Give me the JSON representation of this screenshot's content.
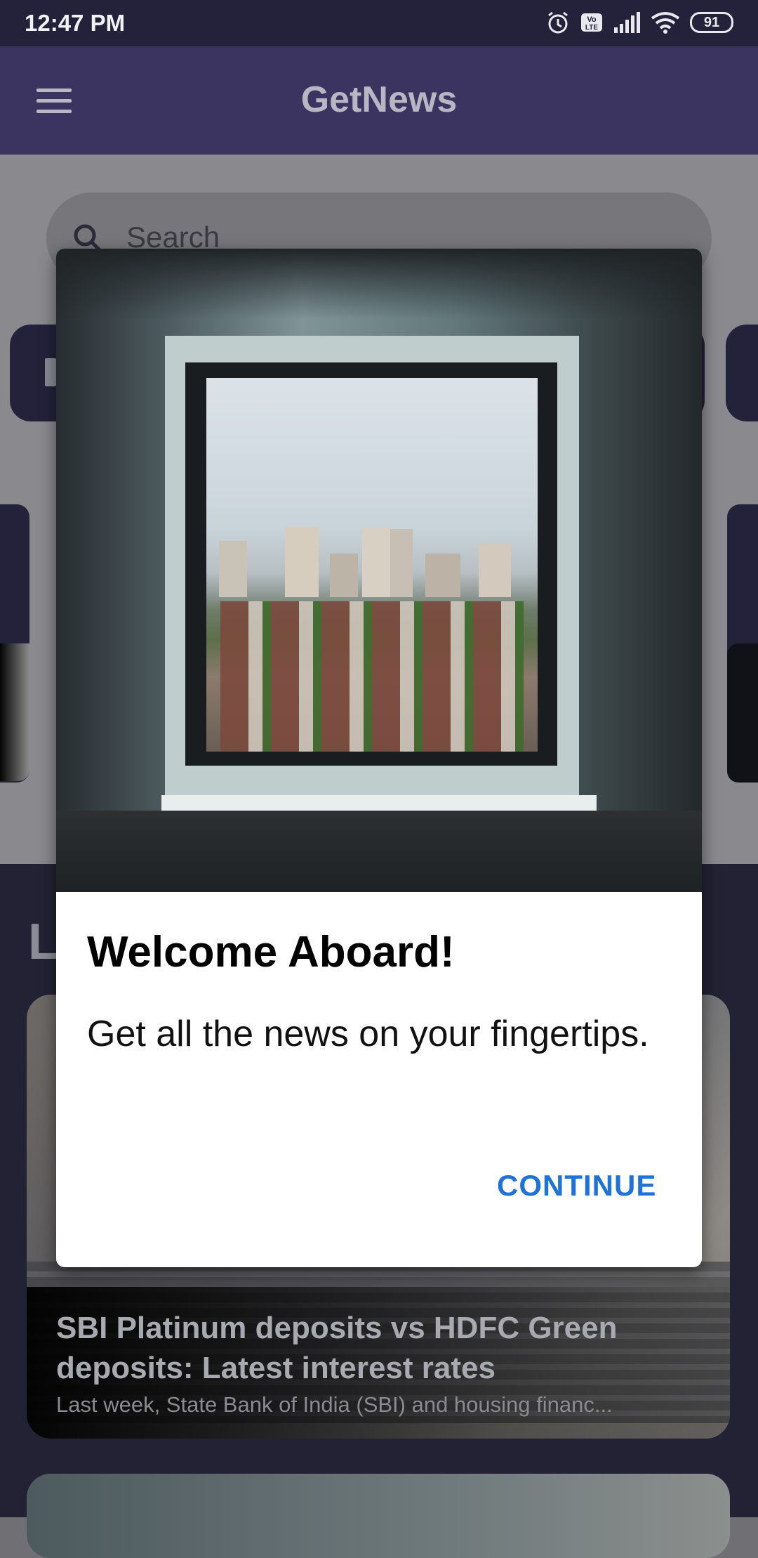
{
  "status_bar": {
    "time": "12:47 PM",
    "battery": "91"
  },
  "app_bar": {
    "title": "GetNews"
  },
  "search": {
    "placeholder": "Search"
  },
  "section": {
    "partial_heading": "L"
  },
  "news": [
    {
      "title": "SBI Platinum deposits vs HDFC Green deposits: Latest interest rates",
      "description": "Last week, State Bank of India (SBI) and housing financ..."
    }
  ],
  "dialog": {
    "title": "Welcome Aboard!",
    "message": "Get all the news on your fingertips.",
    "button": "CONTINUE"
  },
  "colors": {
    "app_bar": "#3c3460",
    "status_bar": "#24223a",
    "accent_button": "#1f73d6",
    "card_dark": "#23223a"
  }
}
